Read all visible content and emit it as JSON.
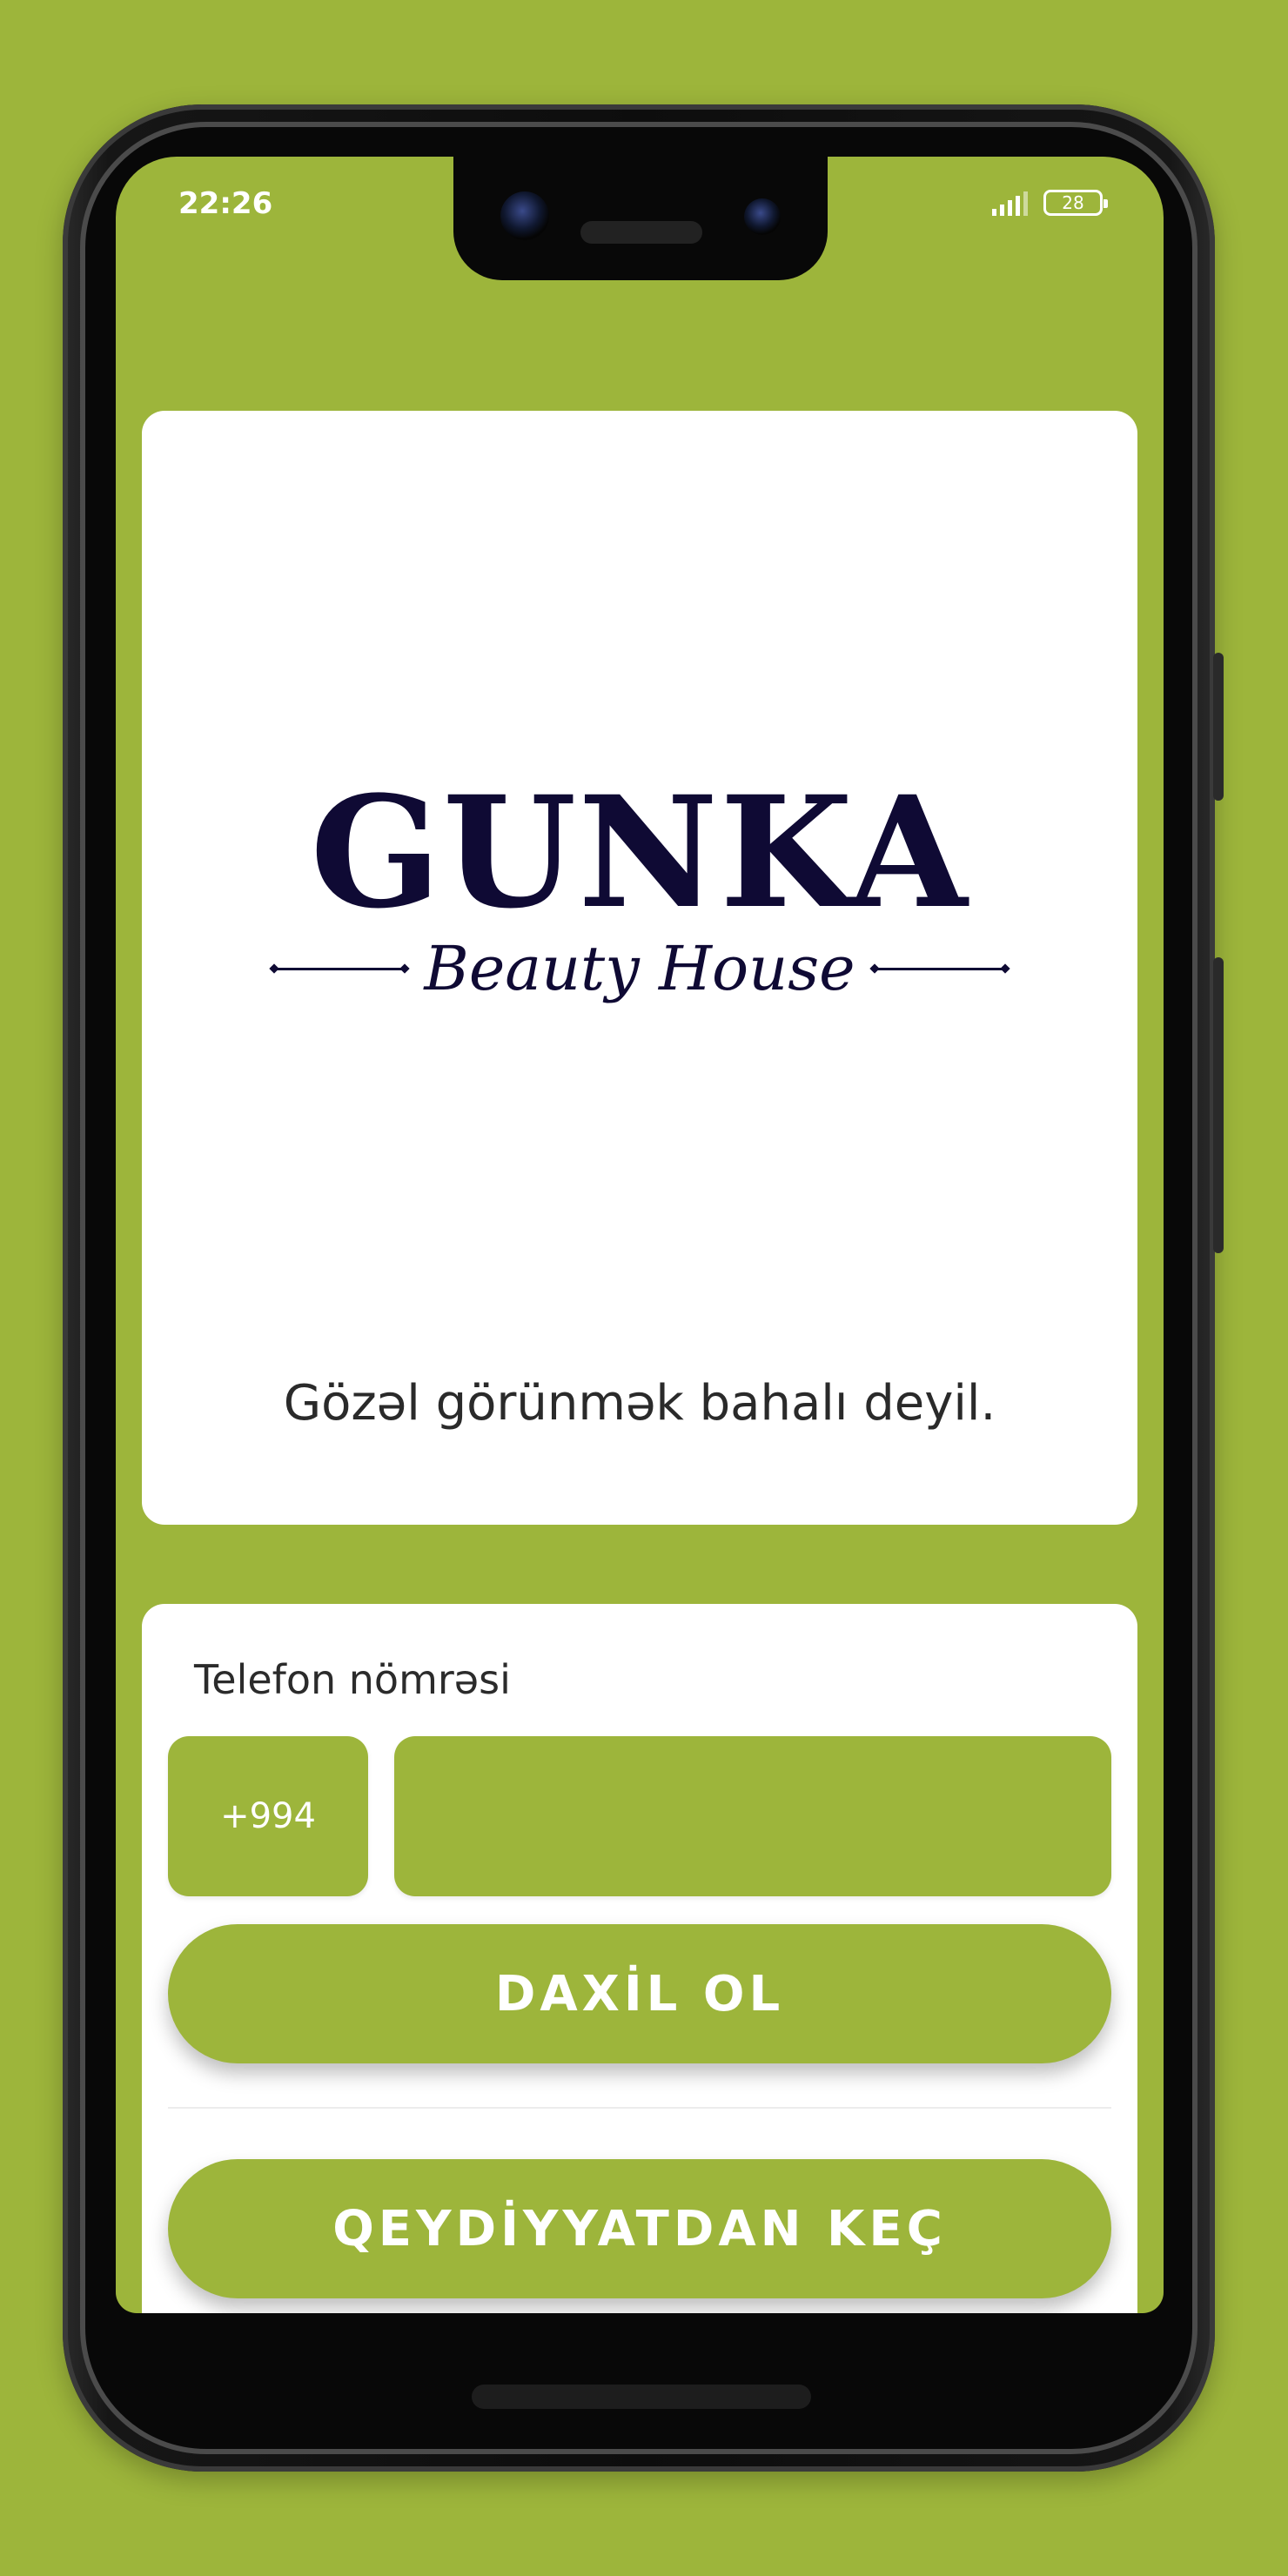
{
  "status_bar": {
    "time": "22:26",
    "battery_level": "28",
    "signal_icon": "signal-bars-icon",
    "battery_icon": "battery-icon"
  },
  "brand": {
    "name": "GUNKA",
    "subtitle": "Beauty House",
    "tagline": "Gözəl görünmək bahalı deyil.",
    "logo_color": "#0f0a34"
  },
  "login": {
    "phone_label": "Telefon nömrəsi",
    "country_code": "+994",
    "phone_value": "",
    "login_button": "DAXİL OL",
    "register_button": "QEYDİYYATDAN KEÇ"
  },
  "colors": {
    "accent": "#9db53b",
    "card": "#ffffff",
    "text": "#2b2b2b"
  }
}
